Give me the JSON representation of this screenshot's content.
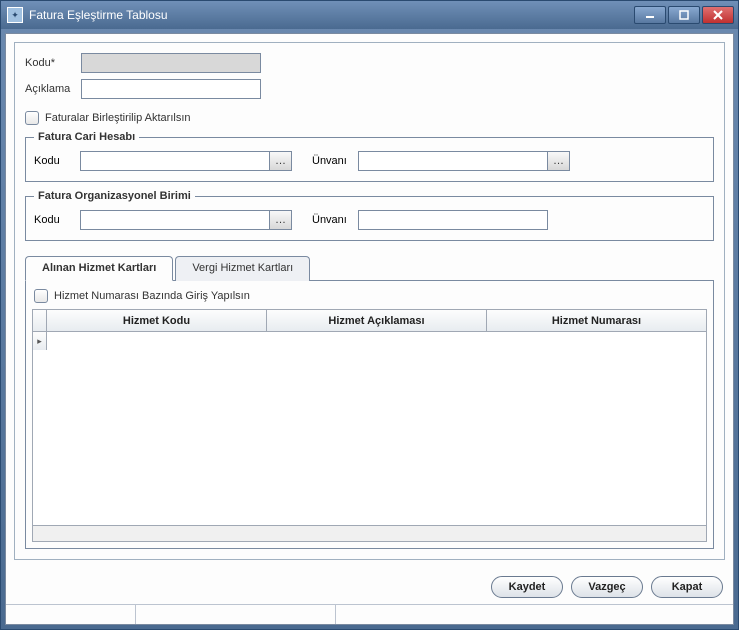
{
  "window": {
    "title": "Fatura Eşleştirme Tablosu"
  },
  "form": {
    "kodu_label": "Kodu*",
    "kodu_value": "",
    "aciklama_label": "Açıklama",
    "aciklama_value": "",
    "merge_checkbox_label": "Faturalar Birleştirilip Aktarılsın"
  },
  "cari": {
    "legend": "Fatura Cari Hesabı",
    "kodu_label": "Kodu",
    "kodu_value": "",
    "unvani_label": "Ünvanı",
    "unvani_value": ""
  },
  "org": {
    "legend": "Fatura Organizasyonel Birimi",
    "kodu_label": "Kodu",
    "kodu_value": "",
    "unvani_label": "Ünvanı",
    "unvani_value": ""
  },
  "tabs": {
    "t1": "Alınan Hizmet Kartları",
    "t2": "Vergi Hizmet Kartları"
  },
  "tab_content": {
    "checkbox_label": "Hizmet Numarası Bazında Giriş Yapılsın",
    "cols": {
      "c1": "Hizmet Kodu",
      "c2": "Hizmet Açıklaması",
      "c3": "Hizmet Numarası"
    }
  },
  "buttons": {
    "save": "Kaydet",
    "cancel": "Vazgeç",
    "close": "Kapat"
  }
}
